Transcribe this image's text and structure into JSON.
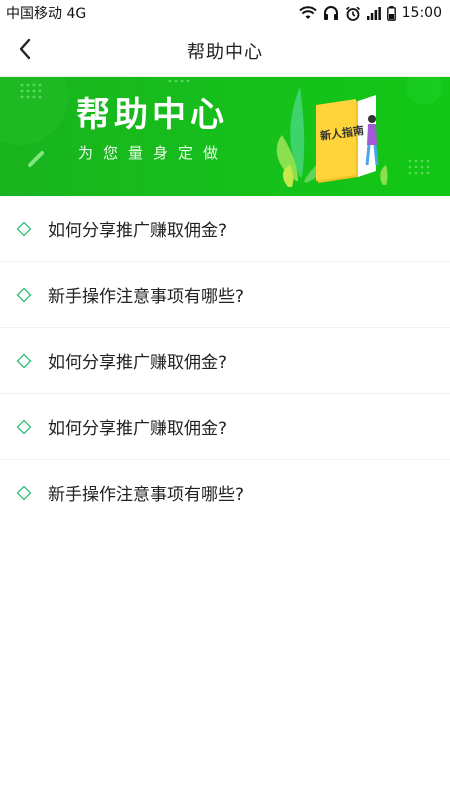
{
  "status_bar": {
    "carrier": "中国移动 4G",
    "time": "15:00"
  },
  "nav": {
    "title": "帮助中心"
  },
  "banner": {
    "title": "帮助中心",
    "subtitle": "为您量身定做",
    "book_label": "新人指南"
  },
  "faq": [
    {
      "question": "如何分享推广赚取佣金?"
    },
    {
      "question": "新手操作注意事项有哪些?"
    },
    {
      "question": "如何分享推广赚取佣金?"
    },
    {
      "question": "如何分享推广赚取佣金?"
    },
    {
      "question": "新手操作注意事项有哪些?"
    }
  ],
  "colors": {
    "accent": "#19b31e",
    "bullet": "#3cbf7f"
  }
}
